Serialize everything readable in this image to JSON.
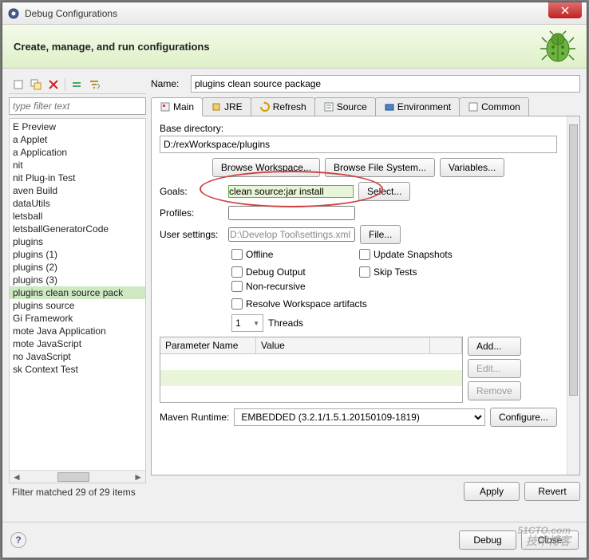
{
  "window": {
    "title": "Debug Configurations"
  },
  "header": {
    "heading": "Create, manage, and run configurations"
  },
  "filter": {
    "placeholder": "type filter text",
    "status": "Filter matched 29 of 29 items"
  },
  "treeItems": [
    "E Preview",
    "a Applet",
    "a Application",
    "nit",
    "nit Plug-in Test",
    "aven Build",
    "dataUtils",
    "letsball",
    "letsballGeneratorCode",
    "plugins",
    "plugins (1)",
    "plugins (2)",
    "plugins (3)",
    "plugins clean source pack",
    "plugins source",
    "Gi Framework",
    "mote Java Application",
    "mote JavaScript",
    "no JavaScript",
    "sk Context Test"
  ],
  "selectedTreeIndex": 13,
  "name": {
    "label": "Name:",
    "value": "plugins clean source package"
  },
  "tabs": [
    "Main",
    "JRE",
    "Refresh",
    "Source",
    "Environment",
    "Common"
  ],
  "form": {
    "baseDirLabel": "Base directory:",
    "baseDirValue": "D:/rexWorkspace/plugins",
    "browseWorkspace": "Browse Workspace...",
    "browseFileSystem": "Browse File System...",
    "variables": "Variables...",
    "goalsLabel": "Goals:",
    "goalsValue": "clean source:jar install",
    "select": "Select...",
    "profilesLabel": "Profiles:",
    "profilesValue": "",
    "userSettingsLabel": "User settings:",
    "userSettingsValue": "D:\\Develop Tool\\settings.xml",
    "file": "File...",
    "checks": {
      "offline": "Offline",
      "updateSnapshots": "Update Snapshots",
      "debugOutput": "Debug Output",
      "skipTests": "Skip Tests",
      "nonRecursive": "Non-recursive",
      "resolveWorkspace": "Resolve Workspace artifacts"
    },
    "threads": {
      "value": "1",
      "label": "Threads"
    },
    "paramTable": {
      "col1": "Parameter Name",
      "col2": "Value"
    },
    "paramButtons": {
      "add": "Add...",
      "edit": "Edit...",
      "remove": "Remove"
    },
    "runtime": {
      "label": "Maven Runtime:",
      "value": "EMBEDDED (3.2.1/1.5.1.20150109-1819)",
      "configure": "Configure..."
    }
  },
  "buttons": {
    "apply": "Apply",
    "revert": "Revert",
    "debug": "Debug",
    "close": "Close"
  },
  "watermark": {
    "main": "51CTO.com",
    "sub": "技术博客"
  }
}
